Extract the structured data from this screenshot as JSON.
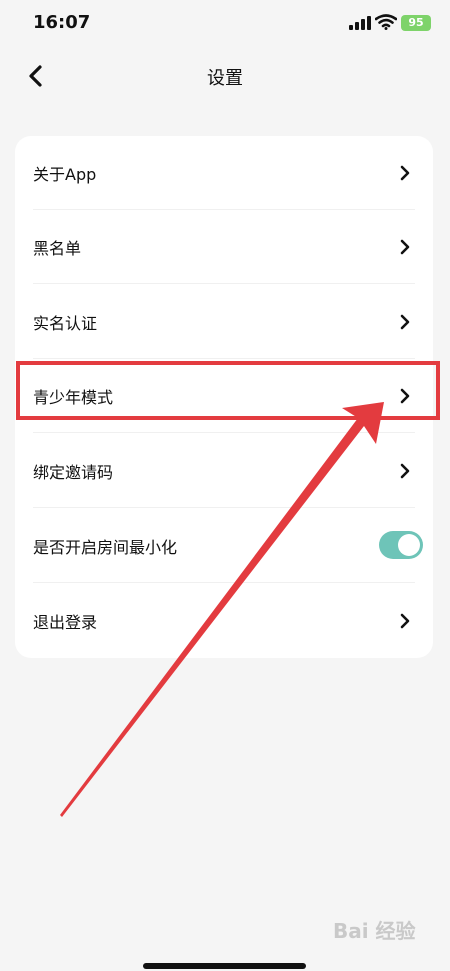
{
  "status": {
    "time": "16:07",
    "battery": "95"
  },
  "nav": {
    "title": "设置"
  },
  "settings": [
    {
      "label": "关于App",
      "type": "link"
    },
    {
      "label": "黑名单",
      "type": "link"
    },
    {
      "label": "实名认证",
      "type": "link"
    },
    {
      "label": "青少年模式",
      "type": "link"
    },
    {
      "label": "绑定邀请码",
      "type": "link"
    },
    {
      "label": "是否开启房间最小化",
      "type": "toggle",
      "enabled": true
    },
    {
      "label": "退出登录",
      "type": "link"
    }
  ],
  "watermark": "Bai 经验",
  "colors": {
    "toggle_on": "#6ec4b8",
    "annotation": "#e33b3f",
    "battery": "#7ed36a"
  }
}
